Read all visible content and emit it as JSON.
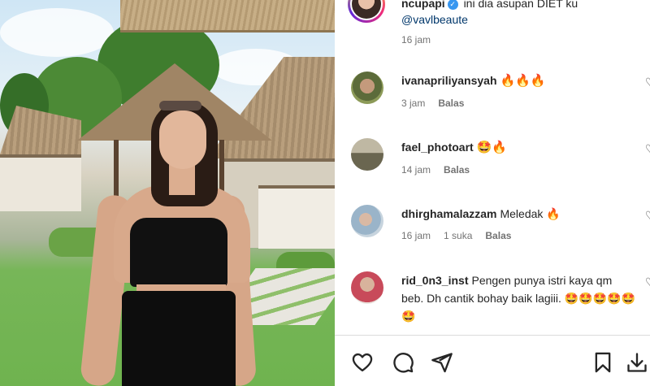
{
  "post": {
    "author": "ncupapi",
    "caption_text": "ini dia asupan DIET ku",
    "mention": "@vavlbeaute",
    "age": "16 jam"
  },
  "comments": [
    {
      "username": "ivanapriliyansyah",
      "text": "🔥🔥🔥",
      "time": "3 jam",
      "likes": "",
      "reply_label": "Balas"
    },
    {
      "username": "fael_photoart",
      "text": "🤩🔥",
      "time": "14 jam",
      "likes": "",
      "reply_label": "Balas"
    },
    {
      "username": "dhirghamalazzam",
      "text": "Meledak 🔥",
      "time": "16 jam",
      "likes": "1 suka",
      "reply_label": "Balas"
    },
    {
      "username": "rid_0n3_inst",
      "text": "Pengen punya istri kaya qm beb. Dh cantik bohay baik lagiii. 🤩🤩🤩🤩🤩🤩",
      "time": "",
      "likes": "",
      "reply_label": ""
    }
  ],
  "icons": {
    "like": "heart-icon",
    "comment": "comment-icon",
    "share": "send-icon",
    "save": "bookmark-icon",
    "download": "download-icon"
  },
  "colors": {
    "mention": "#00376b",
    "meta": "#737373",
    "verified": "#3897f0"
  }
}
